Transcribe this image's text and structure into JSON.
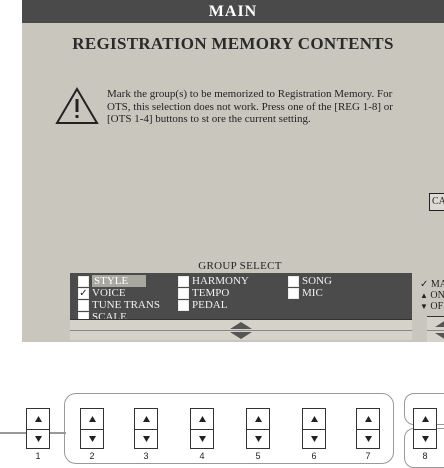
{
  "screen": {
    "title": "MAIN",
    "heading": "REGISTRATION MEMORY CONTENTS",
    "message": "Mark the group(s) to be memorized to Registration Memory. For OTS, this selection does not work. Press one of the [REG 1-8] or [OTS 1-4] buttons to st ore the current setting.",
    "cancel_label": "CANCEL"
  },
  "group_select": {
    "label": "GROUP SELECT",
    "items": [
      {
        "label": "STYLE",
        "checked": false,
        "selected": true
      },
      {
        "label": "VOICE",
        "checked": true,
        "selected": false
      },
      {
        "label": "TUNE TRANS",
        "checked": false,
        "selected": false
      },
      {
        "label": "SCALE",
        "checked": false,
        "selected": false
      },
      {
        "label": "HARMONY",
        "checked": false,
        "selected": false
      },
      {
        "label": "TEMPO",
        "checked": false,
        "selected": false
      },
      {
        "label": "PEDAL",
        "checked": false,
        "selected": false
      },
      {
        "label": "SONG",
        "checked": false,
        "selected": false
      },
      {
        "label": "MIC",
        "checked": false,
        "selected": false
      }
    ]
  },
  "mark_legend": {
    "title": "MARK",
    "on": "ON",
    "off": "OFF"
  },
  "buttons": [
    {
      "number": "1"
    },
    {
      "number": "2"
    },
    {
      "number": "3"
    },
    {
      "number": "4"
    },
    {
      "number": "5"
    },
    {
      "number": "6"
    },
    {
      "number": "7"
    },
    {
      "number": "8"
    }
  ],
  "colors": {
    "screen_bg": "#c9c7bd",
    "title_bar_bg": "#4a4a4a",
    "panel_bg": "#4b4b4b",
    "highlight": "#a8a8a0"
  }
}
